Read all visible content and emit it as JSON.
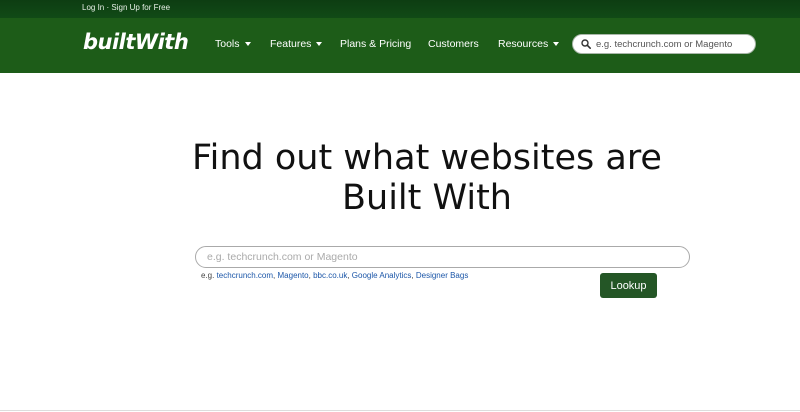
{
  "topbar": {
    "login": "Log In",
    "separator": "·",
    "signup": "Sign Up for Free"
  },
  "logo": {
    "text": "builtWith"
  },
  "nav": {
    "items": [
      {
        "label": "Tools",
        "has_dropdown": true
      },
      {
        "label": "Features",
        "has_dropdown": true
      },
      {
        "label": "Plans & Pricing",
        "has_dropdown": false
      },
      {
        "label": "Customers",
        "has_dropdown": false
      },
      {
        "label": "Resources",
        "has_dropdown": true
      }
    ],
    "search_placeholder": "e.g. techcrunch.com or Magento",
    "search_icon": "search-icon"
  },
  "hero": {
    "line1": "Find out what websites are",
    "line2": "Built With"
  },
  "search": {
    "placeholder": "e.g. techcrunch.com or Magento",
    "value": "",
    "examples_prefix": "e.g.",
    "examples": [
      "techcrunch.com",
      "Magento",
      "bbc.co.uk",
      "Google Analytics",
      "Designer Bags"
    ],
    "lookup_label": "Lookup"
  },
  "colors": {
    "topbar": "#114a16",
    "navbar": "#1d5c18",
    "button": "#245626",
    "link": "#1b56a8"
  }
}
